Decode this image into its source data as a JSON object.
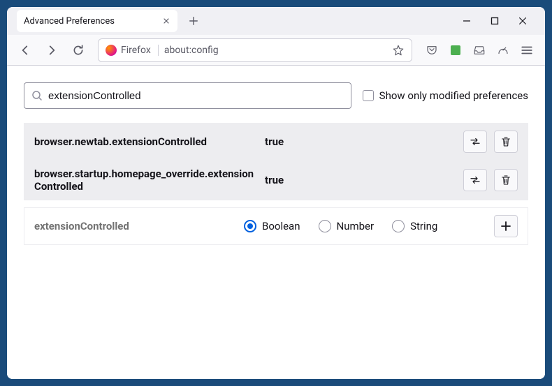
{
  "tab": {
    "title": "Advanced Preferences"
  },
  "urlbar": {
    "identity": "Firefox",
    "url": "about:config"
  },
  "search": {
    "value": "extensionControlled"
  },
  "show_modified": {
    "label": "Show only modified preferences",
    "checked": false
  },
  "prefs": [
    {
      "name": "browser.newtab.extensionControlled",
      "value": "true"
    },
    {
      "name": "browser.startup.homepage_override.extensionControlled",
      "value": "true"
    }
  ],
  "new_pref": {
    "name": "extensionControlled",
    "type": "Boolean",
    "options": [
      "Boolean",
      "Number",
      "String"
    ]
  },
  "chart_data": null
}
